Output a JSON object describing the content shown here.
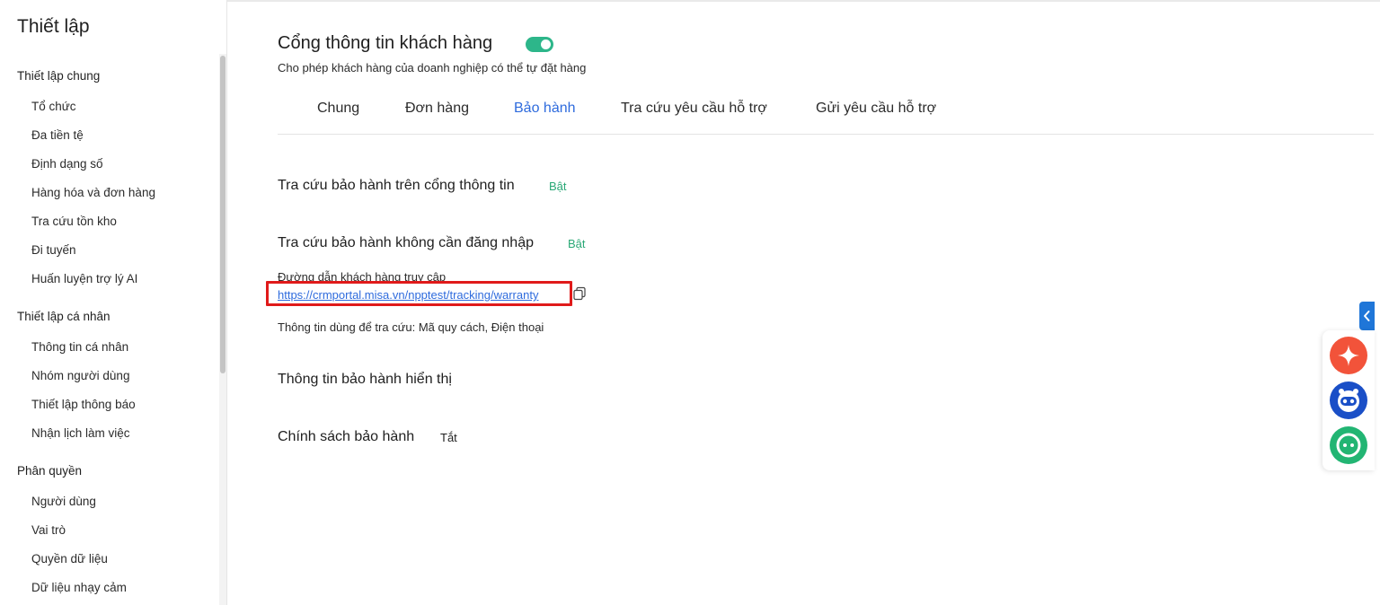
{
  "sidebar": {
    "title": "Thiết lập",
    "sections": [
      {
        "title": "Thiết lập chung",
        "items": [
          "Tổ chức",
          "Đa tiền tệ",
          "Định dạng số",
          "Hàng hóa và đơn hàng",
          "Tra cứu tồn kho",
          "Đi tuyến",
          "Huấn luyện trợ lý AI"
        ]
      },
      {
        "title": "Thiết lập cá nhân",
        "items": [
          "Thông tin cá nhân",
          "Nhóm người dùng",
          "Thiết lập thông báo",
          "Nhận lịch làm việc"
        ]
      },
      {
        "title": "Phân quyền",
        "items": [
          "Người dùng",
          "Vai trò",
          "Quyền dữ liệu",
          "Dữ liệu nhạy cảm"
        ]
      }
    ]
  },
  "header": {
    "title": "Cổng thông tin khách hàng",
    "subtitle": "Cho phép khách hàng của doanh nghiệp có thể tự đặt hàng",
    "toggle_on": true
  },
  "tabs": [
    {
      "label": "Chung",
      "active": false
    },
    {
      "label": "Đơn hàng",
      "active": false
    },
    {
      "label": "Bảo hành",
      "active": true
    },
    {
      "label": "Tra cứu yêu cầu hỗ trợ",
      "active": false
    },
    {
      "label": "Gửi yêu cầu hỗ trợ",
      "active": false
    }
  ],
  "warranty": {
    "lookup_portal": {
      "label": "Tra cứu bảo hành trên cổng thông tin",
      "status": "Bật"
    },
    "lookup_no_login": {
      "label": "Tra cứu bảo hành không cần đăng nhập",
      "status": "Bật"
    },
    "link_caption": "Đường dẫn khách hàng truy cập",
    "link_url": "https://crmportal.misa.vn/npptest/tracking/warranty",
    "lookup_info": "Thông tin dùng để tra cứu: Mã quy cách, Điện thoại",
    "display_info": {
      "label": "Thông tin bảo hành hiển thị"
    },
    "policy": {
      "label": "Chính sách bảo hành",
      "status": "Tắt"
    }
  },
  "colors": {
    "accent": "#2e6bdd",
    "toggle_on": "#2db68a",
    "status_on": "#2aa876",
    "highlight_border": "#e01a1a"
  }
}
